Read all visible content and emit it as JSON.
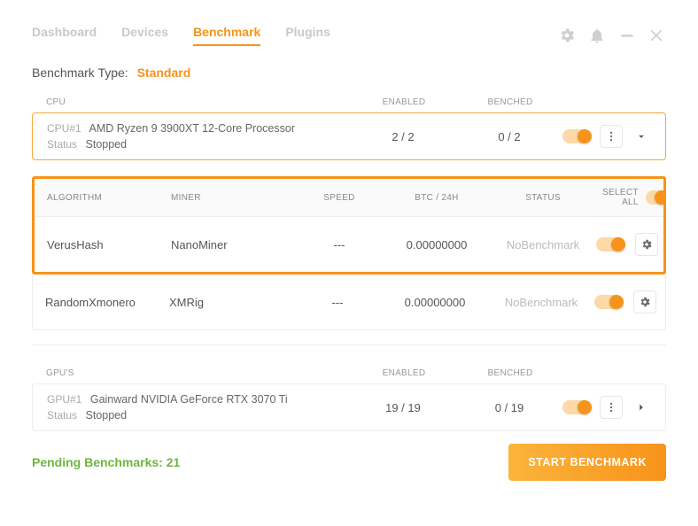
{
  "nav": {
    "tabs": [
      "Dashboard",
      "Devices",
      "Benchmark",
      "Plugins"
    ],
    "active_index": 2
  },
  "benchmark_type": {
    "label": "Benchmark Type:",
    "value": "Standard"
  },
  "cpu_section": {
    "header": {
      "label": "CPU",
      "enabled": "ENABLED",
      "benched": "BENCHED"
    },
    "device": {
      "id_label": "CPU#1",
      "name": "AMD Ryzen 9 3900XT 12-Core Processor",
      "status_label": "Status",
      "status_value": "Stopped",
      "enabled": "2 / 2",
      "benched": "0 / 2"
    }
  },
  "algo": {
    "header": {
      "algorithm": "ALGORITHM",
      "miner": "MINER",
      "speed": "SPEED",
      "btc24": "BTC / 24H",
      "status": "STATUS",
      "selectall": "SELECT ALL"
    },
    "rows": [
      {
        "algorithm": "VerusHash",
        "miner": "NanoMiner",
        "speed": "---",
        "btc24": "0.00000000",
        "status": "NoBenchmark"
      },
      {
        "algorithm": "RandomXmonero",
        "miner": "XMRig",
        "speed": "---",
        "btc24": "0.00000000",
        "status": "NoBenchmark"
      }
    ]
  },
  "gpu_section": {
    "header": {
      "label": "GPU'S",
      "enabled": "ENABLED",
      "benched": "BENCHED"
    },
    "device": {
      "id_label": "GPU#1",
      "name": "Gainward NVIDIA GeForce RTX 3070 Ti",
      "status_label": "Status",
      "status_value": "Stopped",
      "enabled": "19 / 19",
      "benched": "0 / 19"
    }
  },
  "footer": {
    "pending": "Pending Benchmarks: 21",
    "start": "START BENCHMARK"
  }
}
